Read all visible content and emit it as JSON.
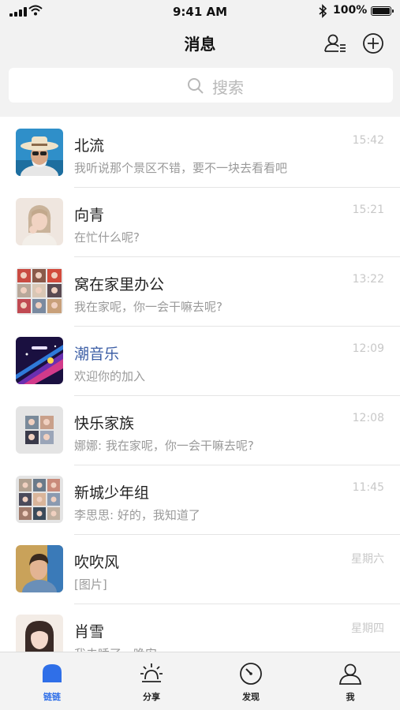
{
  "status_bar": {
    "time": "9:41 AM",
    "battery": "100%"
  },
  "header": {
    "title": "消息"
  },
  "search": {
    "placeholder": "搜索"
  },
  "conversations": [
    {
      "name": "北流",
      "message": "我听说那个景区不错，要不一块去看看吧",
      "time": "15:42"
    },
    {
      "name": "向青",
      "message": "在忙什么呢?",
      "time": "15:21"
    },
    {
      "name": "窝在家里办公",
      "message": "我在家呢，你一会干嘛去呢?",
      "time": "13:22"
    },
    {
      "name": "潮音乐",
      "message": "欢迎你的加入",
      "time": "12:09"
    },
    {
      "name": "快乐家族",
      "message": "娜娜: 我在家呢，你一会干嘛去呢?",
      "time": "12:08"
    },
    {
      "name": "新城少年组",
      "message": "李思思: 好的，我知道了",
      "time": "11:45"
    },
    {
      "name": "吹吹风",
      "message": "[图片]",
      "time": "星期六"
    },
    {
      "name": "肖雪",
      "message": "我去睡了，晚安",
      "time": "星期四"
    }
  ],
  "tabbar": {
    "items": [
      {
        "label": "链链",
        "icon": "chat-bubble-icon",
        "active": true
      },
      {
        "label": "分享",
        "icon": "sun-icon",
        "active": false
      },
      {
        "label": "发现",
        "icon": "compass-icon",
        "active": false
      },
      {
        "label": "我",
        "icon": "person-icon",
        "active": false
      }
    ]
  },
  "colors": {
    "accent": "#2f6fe8",
    "header_bg": "#f2f2f2",
    "tabbar_bg": "#f3f3f3",
    "channel_name": "#3d5fa6"
  }
}
